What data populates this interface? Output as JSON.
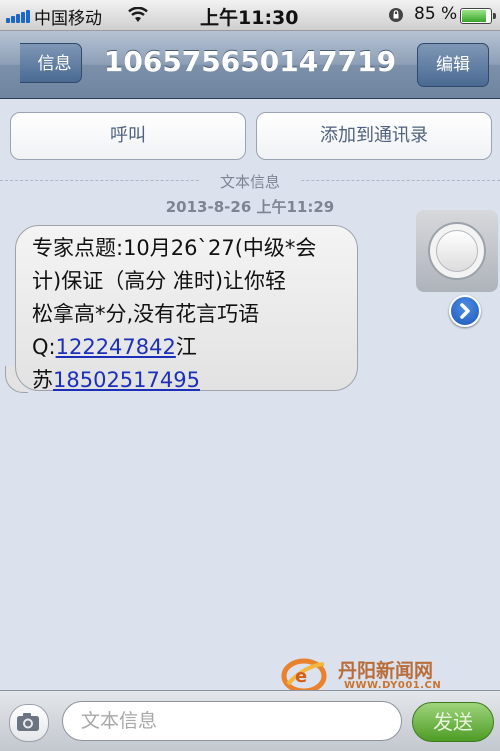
{
  "status_bar": {
    "carrier": "中国移动",
    "time": "上午11:30",
    "battery_percent": "85 %",
    "battery_level": 0.85
  },
  "nav": {
    "back_label": "信息",
    "title": "106575650147719",
    "edit_label": "编辑"
  },
  "actions": {
    "call_label": "呼叫",
    "add_contact_label": "添加到通讯录"
  },
  "thread": {
    "message_type_label": "文本信息",
    "date": "2013-8-26 上午11:29"
  },
  "message": {
    "line1": "专家点题:10月26`27(中级*会",
    "line2": "计)保证（高分 准时)让你轻",
    "line3": "松拿高*分,没有花言巧语",
    "q_prefix": "Q:",
    "q_number": "122247842",
    "q_suffix": "江",
    "phone_prefix": "苏",
    "phone_number": "18502517495"
  },
  "watermark": {
    "title": "丹阳新闻网",
    "url": "WWW.DY001.CN"
  },
  "input": {
    "placeholder": "文本信息",
    "send_label": "发送"
  }
}
